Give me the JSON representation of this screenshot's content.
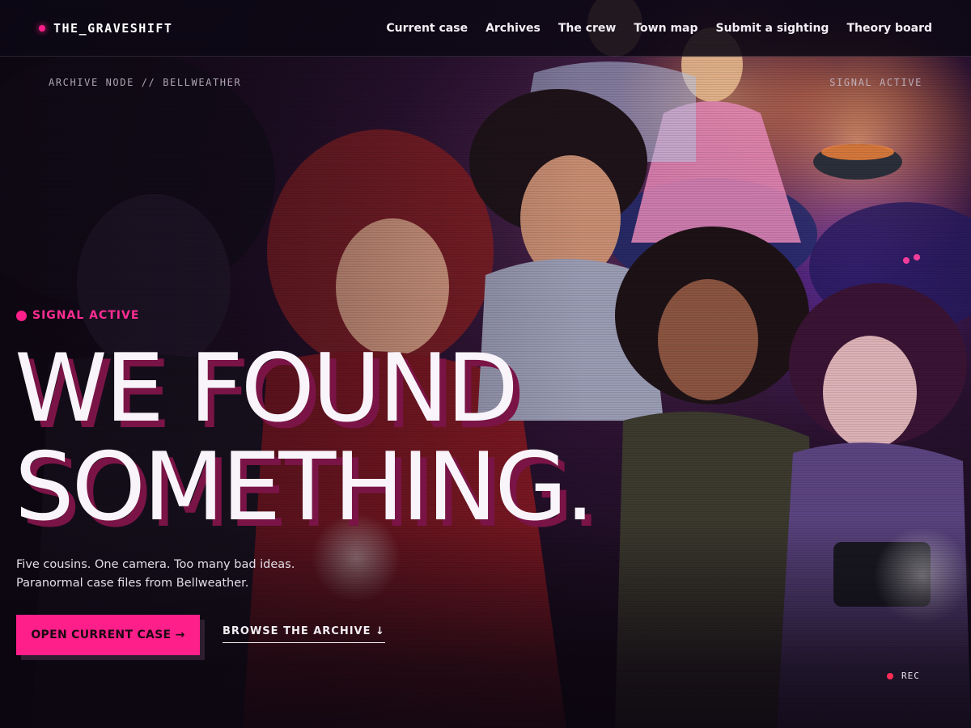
{
  "brand": {
    "name": "THE_GRAVESHIFT"
  },
  "nav": {
    "links": [
      "Current case",
      "Archives",
      "The crew",
      "Town map",
      "Submit a sighting",
      "Theory board"
    ]
  },
  "meta": {
    "left": "ARCHIVE NODE // BELLWEATHER",
    "right": "SIGNAL ACTIVE"
  },
  "hero": {
    "eyebrow": "SIGNAL ACTIVE",
    "headline_lines": [
      "WE FOUND",
      "SOMETHING."
    ],
    "subtext_lines": [
      "Five cousins. One camera. Too many bad ideas.",
      "Paranormal case files from Bellweather."
    ],
    "primary_cta": "OPEN CURRENT CASE →",
    "secondary_cta": "BROWSE THE ARCHIVE ↓",
    "recording_label": "REC"
  },
  "colors": {
    "accent": "#ff1f8a",
    "background": "#0d0812",
    "headline_shadow": "#7a1446"
  }
}
